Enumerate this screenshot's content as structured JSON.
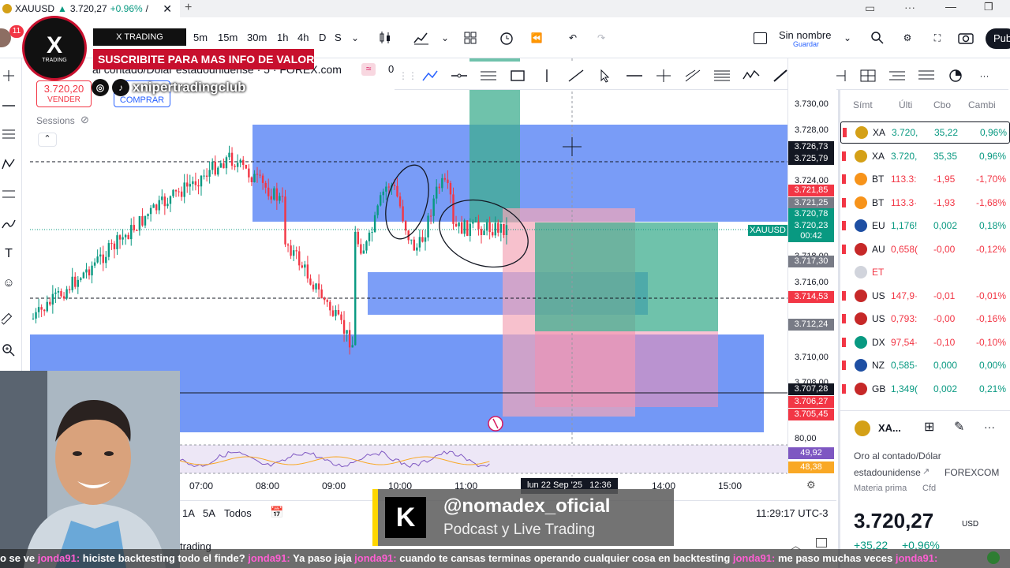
{
  "browser_tab": {
    "symbol": "XAUUSD",
    "price": "3.720,27",
    "change": "+0.96%",
    "sep": "/"
  },
  "toolbar": {
    "timeframes": [
      "5m",
      "15m",
      "30m",
      "1h",
      "4h",
      "D",
      "S"
    ],
    "layout_name": "Sin nombre",
    "layout_sub": "Guardar",
    "publish": "Pub"
  },
  "overlay": {
    "notif_count": "11",
    "logo_text": "X",
    "logo_sub": "TRADING",
    "academy": "X TRADING ACADEMIA",
    "subscribe": "SUSCRIBITE PARA MAS INFO DE VALOR!",
    "handle": "xnipertradingclub"
  },
  "chart_header": {
    "title": "al contado/Dólar estadounidense · 5 · FOREX.com",
    "sell_price": "3.720,20",
    "sell_label": "VENDER",
    "buy_label": "COMPRAR",
    "sessions": "Sessions",
    "zero": "0"
  },
  "price_scale": {
    "labels": [
      "3.730,00",
      "3.728,00",
      "3.724,00",
      "3.718,00",
      "3.716,00",
      "3.710,00",
      "3.708,00",
      "80,00"
    ],
    "tags": [
      {
        "v": "3.726,73",
        "c": "#131722"
      },
      {
        "v": "3.725,79",
        "c": "#131722"
      },
      {
        "v": "3.721,85",
        "c": "#f23645"
      },
      {
        "v": "3.721,25",
        "c": "#787b86"
      },
      {
        "v": "3.720,78",
        "c": "#089981"
      },
      {
        "v": "3.720,23",
        "c": "#089981"
      },
      {
        "v": "00:42",
        "c": "#089981"
      },
      {
        "v": "3.717,30",
        "c": "#787b86"
      },
      {
        "v": "3.714,53",
        "c": "#f23645"
      },
      {
        "v": "3.712,24",
        "c": "#787b86"
      },
      {
        "v": "3.707,28",
        "c": "#131722"
      },
      {
        "v": "3.706,27",
        "c": "#f23645"
      },
      {
        "v": "3.705,45",
        "c": "#f23645"
      },
      {
        "v": "49,92",
        "c": "#7e57c2"
      },
      {
        "v": "48,38",
        "c": "#f9a825"
      }
    ],
    "symbol_tag": "XAUUSD"
  },
  "time_axis": {
    "labels": [
      "07:00",
      "08:00",
      "09:00",
      "10:00",
      "11:00",
      "14:00",
      "15:00"
    ],
    "cursor_label": "lun 22 Sep '25   12:36"
  },
  "bottom_bar": {
    "ranges": [
      "1A",
      "5A",
      "Todos"
    ],
    "clock": "11:29:17 UTC-3",
    "trading": "trading"
  },
  "watchlist": {
    "headers": [
      "Símt",
      "Últi",
      "Cbo",
      "Cambi"
    ],
    "rows": [
      {
        "sym": "XA",
        "last": "3.720,",
        "chg": "35,22",
        "pct": "0,96%",
        "color": "#d4a017",
        "up": true
      },
      {
        "sym": "XA",
        "last": "3.720,",
        "chg": "35,35",
        "pct": "0,96%",
        "color": "#d4a017",
        "up": true
      },
      {
        "sym": "BT",
        "last": "113.3:",
        "chg": "-1,95",
        "pct": "-1,70%",
        "color": "#f7931a",
        "up": false
      },
      {
        "sym": "BT",
        "last": "113.3·",
        "chg": "-1,93",
        "pct": "-1,68%",
        "color": "#f7931a",
        "up": false
      },
      {
        "sym": "EU",
        "last": "1,176!",
        "chg": "0,002",
        "pct": "0,18%",
        "color": "#1e4fa3",
        "up": true
      },
      {
        "sym": "AU",
        "last": "0,658(",
        "chg": "-0,00",
        "pct": "-0,12%",
        "color": "#c62828",
        "up": false
      },
      {
        "sym": "ET",
        "last": "",
        "chg": "",
        "pct": "",
        "color": "#d1d4dc",
        "up": null
      },
      {
        "sym": "US",
        "last": "147,9·",
        "chg": "-0,01",
        "pct": "-0,01%",
        "color": "#c62828",
        "up": false
      },
      {
        "sym": "US",
        "last": "0,793:",
        "chg": "-0,00",
        "pct": "-0,16%",
        "color": "#c62828",
        "up": false
      },
      {
        "sym": "DX",
        "last": "97,54·",
        "chg": "-0,10",
        "pct": "-0,10%",
        "color": "#089981",
        "up": false
      },
      {
        "sym": "NZ",
        "last": "0,585·",
        "chg": "0,000",
        "pct": "0,00%",
        "color": "#1e4fa3",
        "up": true
      },
      {
        "sym": "GB",
        "last": "1,349(",
        "chg": "0,002",
        "pct": "0,21%",
        "color": "#c62828",
        "up": true
      }
    ]
  },
  "details": {
    "sym": "XA...",
    "name1": "Oro al contado/Dólar",
    "name2": "estadounidense",
    "exch": "FOREXCOM",
    "category": "Materia prima",
    "cat2": "Cfd",
    "price": "3.720,27",
    "currency": "USD",
    "change": "+35,22",
    "change_pct": "+0,96%"
  },
  "banner": {
    "handle": "@nomadex_oficial",
    "subtitle": "Podcast y Live Trading",
    "logo": "K"
  },
  "ticker": [
    {
      "u": "",
      "t": "o se ve "
    },
    {
      "u": "jonda91:",
      "t": " hiciste backtesting todo el finde? "
    },
    {
      "u": "jonda91:",
      "t": " Ya paso jaja "
    },
    {
      "u": "jonda91:",
      "t": " cuando te cansas terminas operando cualquier cosa en backtesting "
    },
    {
      "u": "jonda91:",
      "t": " me paso muchas veces "
    },
    {
      "u": "jonda91:",
      "t": " "
    }
  ],
  "colors": {
    "up": "#089981",
    "down": "#f23645",
    "zone": "#5b86f5",
    "accent": "#2962ff"
  }
}
